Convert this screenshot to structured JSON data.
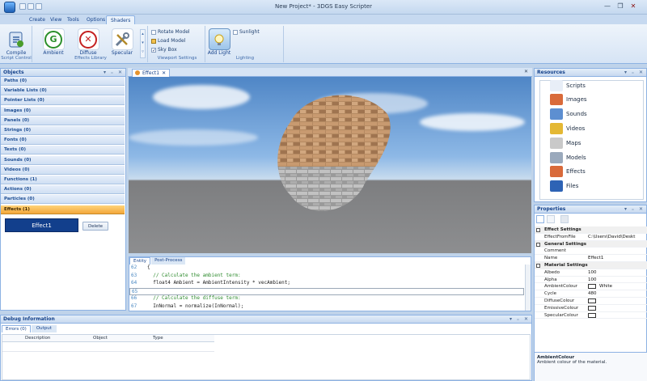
{
  "window": {
    "title": "New Project* - 3DGS Easy Scripter",
    "min_glyph": "—",
    "max_glyph": "❐",
    "close_glyph": "✕"
  },
  "ribbon": {
    "tabs": [
      {
        "label": "Create"
      },
      {
        "label": "View"
      },
      {
        "label": "Tools"
      },
      {
        "label": "Options"
      },
      {
        "label": "Shaders"
      }
    ],
    "groups": {
      "script_control": {
        "label": "Script Control",
        "compile": "Compile"
      },
      "effects_library": {
        "label": "Effects Library",
        "ambient": "Ambient",
        "diffuse": "Diffuse",
        "specular": "Specular"
      },
      "viewport_settings": {
        "label": "Viewport Settings",
        "rotate_model": "Rotate Model",
        "load_model": "Load Model",
        "sky_box": "Sky Box"
      },
      "lighting": {
        "label": "Lighting",
        "add_light": "Add Light",
        "sunlight": "Sunlight"
      }
    }
  },
  "objects_panel": {
    "title": "Objects",
    "pin_glyphs": "▾ ₌ ✕",
    "categories": [
      "Paths (0)",
      "Variable Lists (0)",
      "Pointer Lists (0)",
      "Images (0)",
      "Panels (0)",
      "Strings (0)",
      "Fonts (0)",
      "Texts (0)",
      "Sounds (0)",
      "Videos (0)",
      "Functions (1)",
      "Actions (0)",
      "Particles (0)",
      "Effects (1)"
    ],
    "selected_item": "Effect1",
    "delete_label": "Delete"
  },
  "document": {
    "tab_label": "Effect1",
    "tab_close": "✕",
    "close_all": "✕",
    "editor_tabs": [
      "Entity",
      "Post-Process"
    ],
    "code_lines": [
      {
        "num": "62",
        "text": "{"
      },
      {
        "num": "63",
        "text": "  // Calculate the ambient term:"
      },
      {
        "num": "64",
        "text": "  float4 Ambient = AmbientIntensity * vecAmbient;"
      },
      {
        "num": "65",
        "text": ""
      },
      {
        "num": "66",
        "text": "  // Calculate the diffuse term:"
      },
      {
        "num": "67",
        "text": "  InNormal = normalize(InNormal);"
      }
    ]
  },
  "resources_panel": {
    "title": "Resources",
    "pin_glyphs": "▾ ₌ ✕",
    "items": [
      "Scripts",
      "Images",
      "Sounds",
      "Videos",
      "Maps",
      "Models",
      "Effects",
      "Files"
    ]
  },
  "properties_panel": {
    "title": "Properties",
    "pin_glyphs": "▾ ₌ ✕",
    "rows": [
      {
        "kind": "cat",
        "name": "Effect Settings",
        "value": ""
      },
      {
        "kind": "prop",
        "name": "EffectFromFile",
        "value": "C:\\Users\\David\\Deskt"
      },
      {
        "kind": "cat",
        "name": "General Settings",
        "value": ""
      },
      {
        "kind": "prop",
        "name": "Comment",
        "value": ""
      },
      {
        "kind": "prop",
        "name": "Name",
        "value": "Effect1"
      },
      {
        "kind": "cat",
        "name": "Material Settings",
        "value": ""
      },
      {
        "kind": "prop",
        "name": "Albedo",
        "value": "100"
      },
      {
        "kind": "prop",
        "name": "Alpha",
        "value": "100"
      },
      {
        "kind": "prop",
        "name": "AmbientColour",
        "value": "White"
      },
      {
        "kind": "prop",
        "name": "Cycle",
        "value": "480"
      },
      {
        "kind": "prop",
        "name": "DiffuseColour",
        "value": ""
      },
      {
        "kind": "prop",
        "name": "EmissiveColour",
        "value": ""
      },
      {
        "kind": "prop",
        "name": "SpecularColour",
        "value": ""
      }
    ],
    "help_title": "AmbientColour",
    "help_text": "Ambient colour of the material."
  },
  "debug_panel": {
    "title": "Debug Information",
    "pin_glyphs": "▾ ₌ ✕",
    "tabs": [
      "Errors (0)",
      "Output"
    ],
    "columns": [
      "Description",
      "Object",
      "Type"
    ]
  },
  "colors": {
    "accent": "#15428b",
    "selected_category": "#f3a73a",
    "selected_item": "#123f8c"
  }
}
